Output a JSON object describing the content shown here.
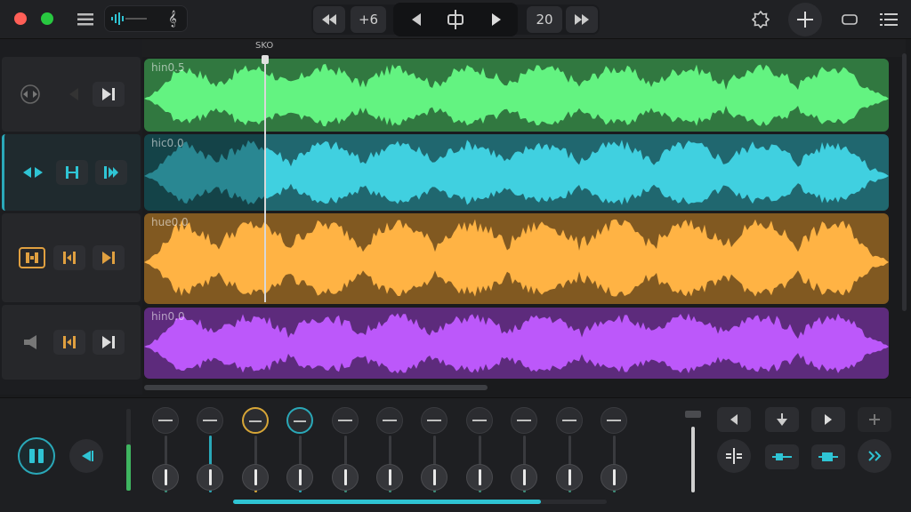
{
  "window": {
    "close_color": "#ff5f57",
    "zoom_color": "#28c840"
  },
  "transport": {
    "nudge_back_value": "+6",
    "tempo_value": "20",
    "playhead_time": "SKO"
  },
  "tracks": [
    {
      "name": "hin0.5",
      "color": "#4fc267"
    },
    {
      "name": "hic0.0",
      "color": "#33a6b3"
    },
    {
      "name": "hue0.0",
      "color": "#d08f36"
    },
    {
      "name": "hin0.0",
      "color": "#9646c8"
    }
  ],
  "icons": {
    "menu": "hamburger-icon",
    "levels": "waveform-meter-icon",
    "clef": "clef-icon",
    "rewind": "rewind-icon",
    "prev": "prev-icon",
    "crosshair": "split-icon",
    "play": "play-icon",
    "ffwd": "fast-forward-icon",
    "star": "badge-icon",
    "marker": "add-marker-icon",
    "chat": "chat-icon",
    "list": "list-icon"
  },
  "mixer": {
    "channel_count": 11,
    "accent": "#2aa8b8"
  },
  "colors": {
    "accent": "#2aa8b8",
    "selected_track_border": "#2aa8b8"
  }
}
